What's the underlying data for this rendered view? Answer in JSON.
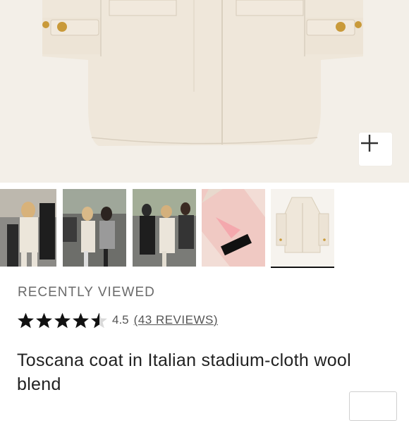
{
  "recently_viewed_label": "RECENTLY VIEWED",
  "rating": {
    "value_text": "4.5",
    "stars_filled_fraction": 0.9,
    "reviews_open": "(",
    "reviews_link": "43 REVIEWS",
    "reviews_close": ")"
  },
  "product_title": "Toscana coat in Italian stadium-cloth wool blend",
  "zoom_button_icon": "plus-icon",
  "colors": {
    "hero_bg": "#f3efe8",
    "coat": "#efe7da",
    "text": "#222222",
    "muted": "#6b6b6b"
  }
}
